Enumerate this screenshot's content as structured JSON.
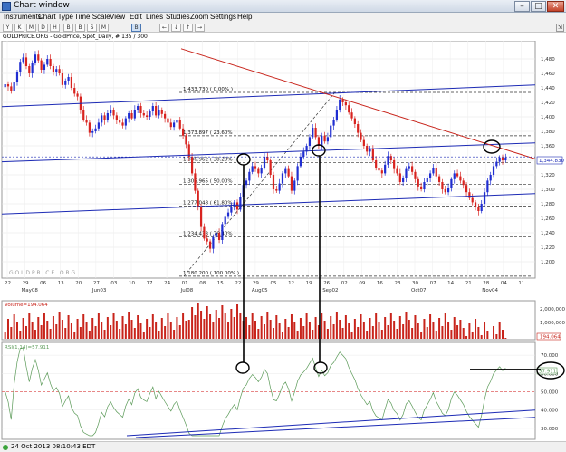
{
  "window": {
    "title": "Chart window",
    "minimize": "–",
    "maximize": "□",
    "close": "✕"
  },
  "menu": [
    "Instruments",
    "Chart Type",
    "Time Scale",
    "View",
    "Edit",
    "Lines",
    "Studies",
    "Zoom",
    "Settings",
    "Help"
  ],
  "toolbar": {
    "buttons": [
      "Y",
      "K",
      "M",
      "D",
      "H",
      "B",
      "B",
      "S",
      "M",
      "B"
    ],
    "arrows": [
      "←",
      "↓",
      "↑",
      "→"
    ],
    "pin": "⇲"
  },
  "symbol": "GOLDPRICE.ORG - GoldPrice, Spot_Daily, # 135 / 300",
  "watermark": "G O L D P R I C E . O R G",
  "colors": {
    "up": "#1f2dd1",
    "down": "#d8231f",
    "channel": "#1d2bb5",
    "resistance": "#c8241b",
    "volume": "#c8241b",
    "rsi_line": "#5b9a58",
    "rsi_ref": "#e06060"
  },
  "chart_data": [
    {
      "type": "candlestick",
      "ylim": [
        1180,
        1500
      ],
      "y_ticks": [
        "1,200",
        "1,220",
        "1,240",
        "1,260",
        "1,280",
        "1,300",
        "1,320",
        "1,340",
        "1,360",
        "1,380",
        "1,400",
        "1,420",
        "1,440",
        "1,460",
        "1,480"
      ],
      "x_ticks": [
        "22",
        "29",
        "06",
        "13",
        "20",
        "27",
        "03",
        "10",
        "17",
        "24",
        "01",
        "08",
        "15",
        "22",
        "29",
        "05",
        "12",
        "19",
        "26",
        "02",
        "09",
        "16",
        "23",
        "30",
        "07",
        "14",
        "21",
        "28",
        "04",
        "11"
      ],
      "x_month_labels": [
        "May08",
        "Jun03",
        "Jul08",
        "Aug05",
        "Sep02",
        "Oct07",
        "Nov04"
      ],
      "last_price": "1,344.830",
      "prev_price": "1,340",
      "closes": [
        1445,
        1442,
        1435,
        1448,
        1462,
        1476,
        1482,
        1470,
        1460,
        1474,
        1486,
        1478,
        1465,
        1472,
        1480,
        1470,
        1462,
        1466,
        1460,
        1444,
        1450,
        1455,
        1440,
        1432,
        1428,
        1410,
        1396,
        1392,
        1378,
        1380,
        1384,
        1392,
        1402,
        1395,
        1405,
        1410,
        1402,
        1396,
        1392,
        1388,
        1398,
        1405,
        1398,
        1410,
        1415,
        1405,
        1402,
        1400,
        1408,
        1415,
        1402,
        1410,
        1404,
        1398,
        1392,
        1386,
        1392,
        1395,
        1384,
        1374,
        1362,
        1345,
        1322,
        1298,
        1276,
        1248,
        1232,
        1228,
        1218,
        1234,
        1240,
        1230,
        1252,
        1262,
        1268,
        1276,
        1282,
        1272,
        1290,
        1306,
        1312,
        1324,
        1332,
        1328,
        1322,
        1330,
        1345,
        1340,
        1320,
        1300,
        1298,
        1308,
        1322,
        1328,
        1318,
        1298,
        1312,
        1332,
        1345,
        1352,
        1360,
        1372,
        1385,
        1372,
        1360,
        1374,
        1366,
        1372,
        1388,
        1396,
        1410,
        1424,
        1420,
        1416,
        1406,
        1398,
        1390,
        1378,
        1368,
        1360,
        1352,
        1356,
        1340,
        1330,
        1326,
        1322,
        1334,
        1346,
        1340,
        1328,
        1322,
        1310,
        1316,
        1328,
        1332,
        1324,
        1314,
        1304,
        1300,
        1310,
        1316,
        1322,
        1330,
        1318,
        1310,
        1300,
        1296,
        1302,
        1314,
        1322,
        1318,
        1312,
        1306,
        1296,
        1288,
        1282,
        1276,
        1270,
        1280,
        1296,
        1312,
        1320,
        1332,
        1338,
        1344,
        1340,
        1344
      ],
      "fibonacci": [
        {
          "price": 1433.73,
          "label": "1,433.730 ( 0.00% )"
        },
        {
          "price": 1373.897,
          "label": "1,373.897 ( 23.60% )"
        },
        {
          "price": 1336.962,
          "label": "1,336.962 ( 38.20% )"
        },
        {
          "price": 1306.965,
          "label": "1,306.965 ( 50.00% )"
        },
        {
          "price": 1277.048,
          "label": "1,277.048 ( 61.80% )"
        },
        {
          "price": 1234.433,
          "label": "1,234.433 ( 76.40% )"
        },
        {
          "price": 1180.2,
          "label": "1,180.200 ( 100.00% )"
        }
      ]
    },
    {
      "type": "bar",
      "series_label": "Volume=194.064",
      "y_ticks": [
        "2,000,000",
        "1,000,000"
      ],
      "value_badge": "194.064"
    },
    {
      "type": "line",
      "series_label": "RSI(1,14)=57.911",
      "y_ticks": [
        "70.000",
        "60.000",
        "50.000",
        "40.000",
        "30.000"
      ],
      "value_badge": "57.911",
      "ylim": [
        25,
        75
      ]
    }
  ],
  "status": {
    "timestamp": "24 Oct 2013 08:10:43 EDT"
  }
}
